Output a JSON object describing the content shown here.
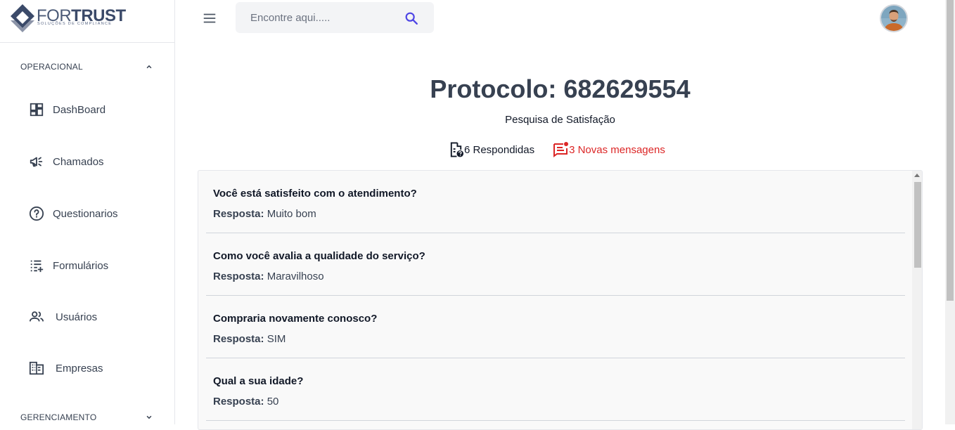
{
  "logo": {
    "for": "FOR",
    "trust": "TRUST",
    "tagline": "SOLUÇÕES DE COMPLIANCE"
  },
  "sidebar": {
    "section_operacional": "OPERACIONAL",
    "section_gerenciamento": "GERENCIAMENTO",
    "items": [
      {
        "label": "DashBoard",
        "icon": "dashboard-icon"
      },
      {
        "label": "Chamados",
        "icon": "megaphone-icon"
      },
      {
        "label": "Questionarios",
        "icon": "help-circle-icon"
      },
      {
        "label": "Formulários",
        "icon": "playlist-add-icon"
      },
      {
        "label": "Usuários",
        "icon": "people-icon"
      },
      {
        "label": "Empresas",
        "icon": "business-icon"
      }
    ]
  },
  "search": {
    "placeholder": "Encontre aqui....."
  },
  "header": {
    "title": "Protocolo: 682629554",
    "subtitle": "Pesquisa de Satisfação",
    "responded": "6 Respondidas",
    "new_messages": "3 Novas mensagens"
  },
  "answer_prefix": "Resposta:",
  "questions": [
    {
      "question": "Você está satisfeito com o atendimento?",
      "answer": "Muito bom"
    },
    {
      "question": "Como você avalia a qualidade do serviço?",
      "answer": "Maravilhoso"
    },
    {
      "question": "Compraria novamente conosco?",
      "answer": "SIM"
    },
    {
      "question": "Qual a sua idade?",
      "answer": "50"
    }
  ],
  "colors": {
    "accent": "#4f46e5",
    "alert": "#dc2626",
    "text": "#374151"
  }
}
